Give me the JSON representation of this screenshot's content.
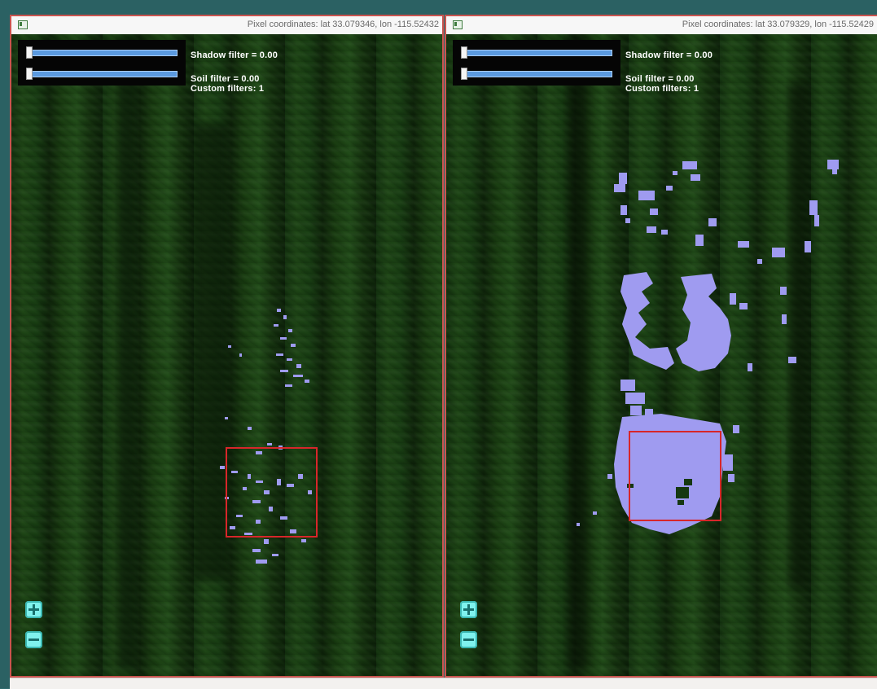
{
  "colors": {
    "mask": "#9f9bf0",
    "roi": "#d7262a",
    "slider": "#5b9ae0",
    "zoom": "#7ff2ee"
  },
  "viewers": [
    {
      "coordinates": "Pixel coordinates: lat 33.079346, lon -115.52432",
      "shadow_filter": "Shadow filter = 0.00",
      "soil_filter": "Soil filter = 0.00",
      "custom_filters": "Custom filters: 1",
      "shadow_slider_value": 0,
      "soil_slider_value": 0,
      "zoom_in_icon": "plus-icon",
      "zoom_out_icon": "minus-icon"
    },
    {
      "coordinates": "Pixel coordinates: lat 33.079329, lon -115.52429",
      "shadow_filter": "Shadow filter = 0.00",
      "soil_filter": "Soil filter = 0.00",
      "custom_filters": "Custom filters: 1",
      "shadow_slider_value": 0,
      "soil_slider_value": 0,
      "zoom_in_icon": "plus-icon",
      "zoom_out_icon": "minus-icon"
    }
  ]
}
